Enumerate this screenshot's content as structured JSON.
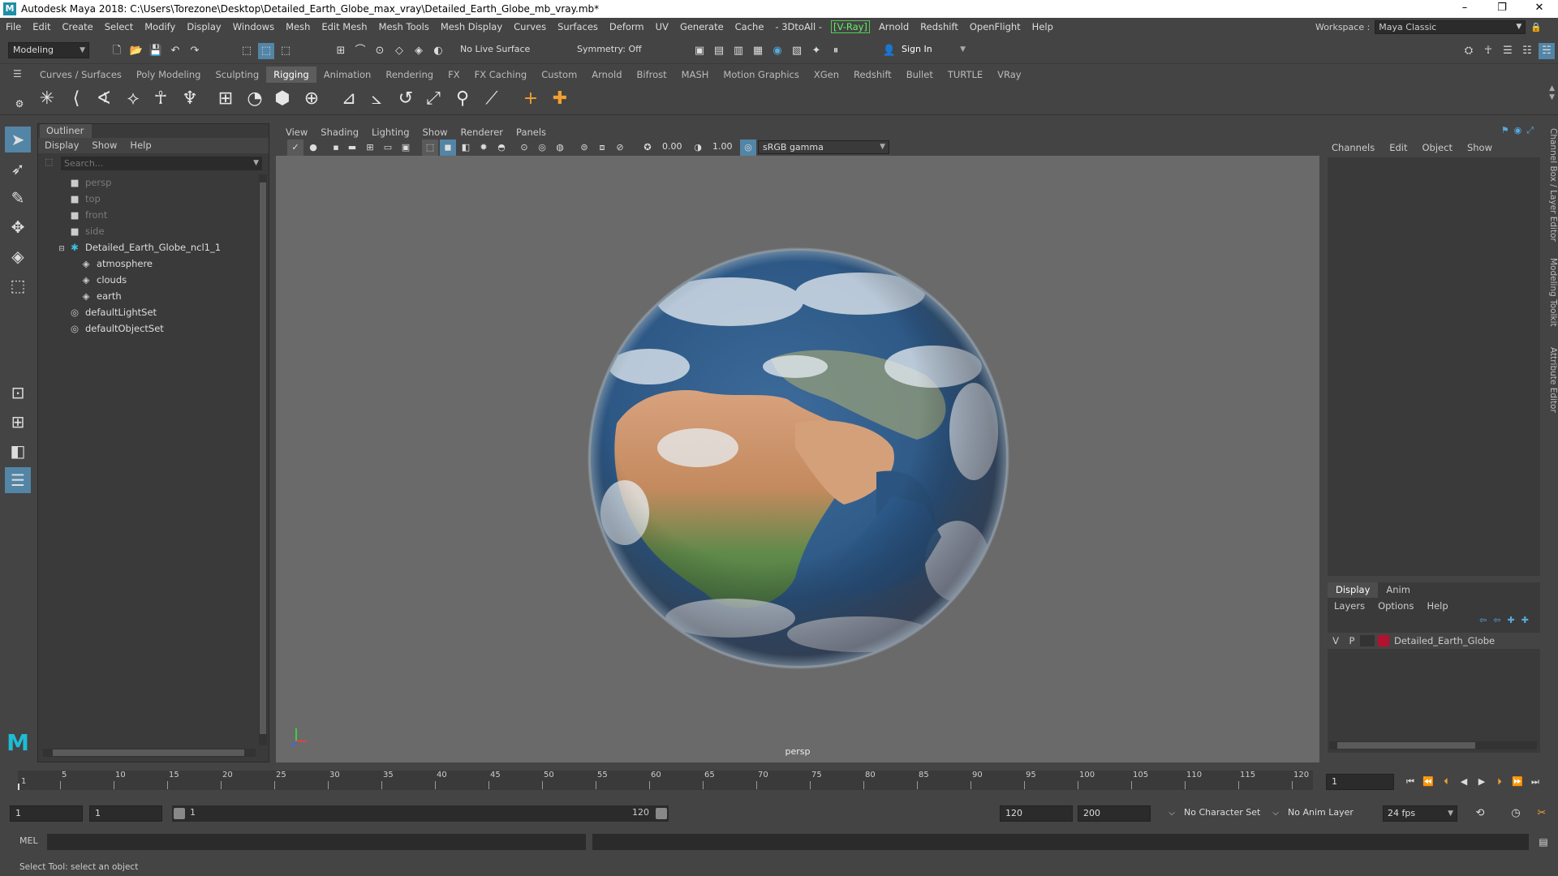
{
  "window": {
    "title": "Autodesk Maya 2018: C:\\Users\\Torezone\\Desktop\\Detailed_Earth_Globe_max_vray\\Detailed_Earth_Globe_mb_vray.mb*",
    "minimize": "–",
    "restore": "❐",
    "close": "✕"
  },
  "menubar": {
    "items": [
      "File",
      "Edit",
      "Create",
      "Select",
      "Modify",
      "Display",
      "Windows",
      "Mesh",
      "Edit Mesh",
      "Mesh Tools",
      "Mesh Display",
      "Curves",
      "Surfaces",
      "Deform",
      "UV",
      "Generate",
      "Cache",
      "- 3DtoAll -"
    ],
    "vray": "[V-Ray]",
    "items2": [
      "Arnold",
      "Redshift",
      "OpenFlight",
      "Help"
    ],
    "workspace_label": "Workspace :",
    "workspace_value": "Maya Classic"
  },
  "statusline": {
    "mode": "Modeling",
    "live_surface": "No Live Surface",
    "symmetry": "Symmetry: Off",
    "sign_in": "Sign In"
  },
  "shelf": {
    "tabs": [
      "Curves / Surfaces",
      "Poly Modeling",
      "Sculpting",
      "Rigging",
      "Animation",
      "Rendering",
      "FX",
      "FX Caching",
      "Custom",
      "Arnold",
      "Bifrost",
      "MASH",
      "Motion Graphics",
      "XGen",
      "Redshift",
      "Bullet",
      "TURTLE",
      "VRay"
    ],
    "active": "Rigging"
  },
  "outliner": {
    "tab": "Outliner",
    "menu": [
      "Display",
      "Show",
      "Help"
    ],
    "search_placeholder": "Search...",
    "items": [
      {
        "label": "persp",
        "dim": true
      },
      {
        "label": "top",
        "dim": true
      },
      {
        "label": "front",
        "dim": true
      },
      {
        "label": "side",
        "dim": true
      },
      {
        "label": "Detailed_Earth_Globe_ncl1_1",
        "dim": false
      },
      {
        "label": "atmosphere",
        "dim": false
      },
      {
        "label": "clouds",
        "dim": false
      },
      {
        "label": "earth",
        "dim": false
      },
      {
        "label": "defaultLightSet",
        "dim": false
      },
      {
        "label": "defaultObjectSet",
        "dim": false
      }
    ]
  },
  "viewport": {
    "menu": [
      "View",
      "Shading",
      "Lighting",
      "Show",
      "Renderer",
      "Panels"
    ],
    "exposure": "0.00",
    "gamma": "1.00",
    "colorspace": "sRGB gamma",
    "camera_label": "persp"
  },
  "channelbox": {
    "menu": [
      "Channels",
      "Edit",
      "Object",
      "Show"
    ],
    "layer_tabs": [
      "Display",
      "Anim"
    ],
    "layer_menu": [
      "Layers",
      "Options",
      "Help"
    ],
    "layer": {
      "v": "V",
      "p": "P",
      "name": "Detailed_Earth_Globe",
      "color": "#b3122e"
    }
  },
  "sidetabs": [
    "Channel Box / Layer Editor",
    "Modeling Toolkit",
    "Attribute Editor"
  ],
  "timeline": {
    "ticks": [
      "5",
      "10",
      "15",
      "20",
      "25",
      "30",
      "35",
      "40",
      "45",
      "50",
      "55",
      "60",
      "65",
      "70",
      "75",
      "80",
      "85",
      "90",
      "95",
      "100",
      "105",
      "110",
      "115",
      "120"
    ],
    "start_label": "1",
    "current_frame": "1"
  },
  "range": {
    "start": "1",
    "playback_start": "1",
    "slider_start": "1",
    "slider_end": "120",
    "playback_end": "120",
    "end": "200",
    "character_set": "No Character Set",
    "anim_layer": "No Anim Layer",
    "fps": "24 fps"
  },
  "cmdline": {
    "label": "MEL"
  },
  "helpline": {
    "text": "Select Tool: select an object"
  }
}
